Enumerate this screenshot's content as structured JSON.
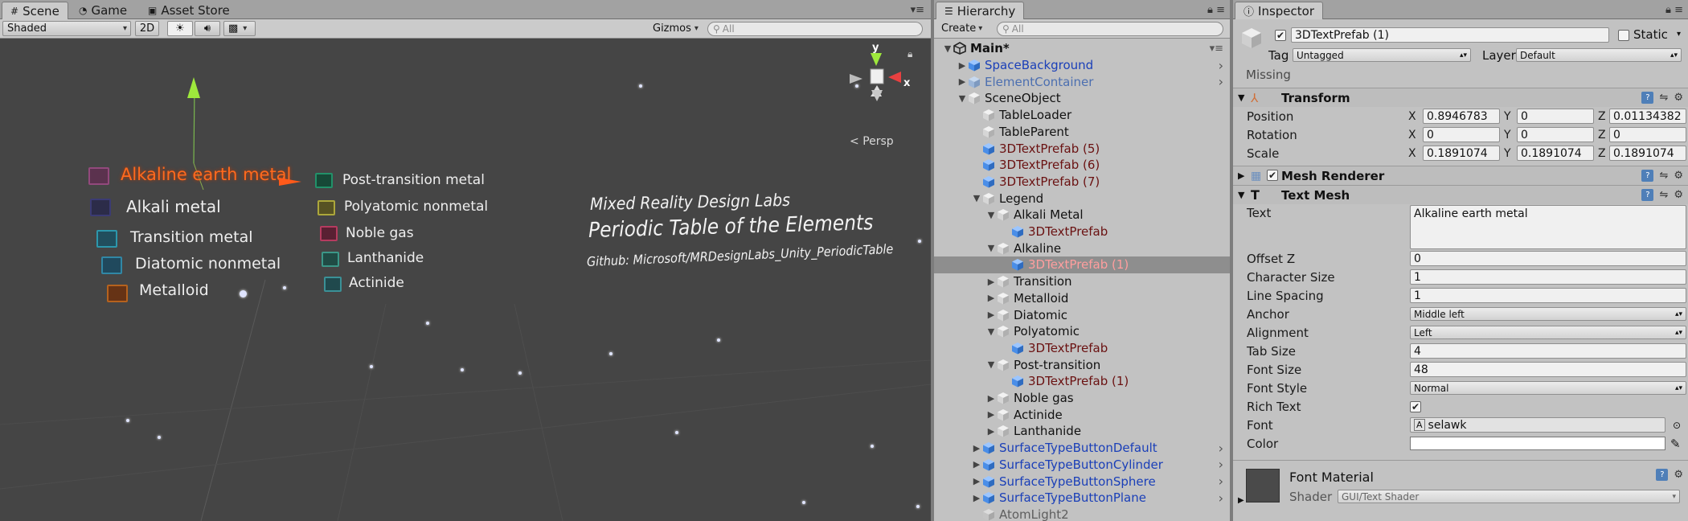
{
  "scene_panel": {
    "tabs": [
      {
        "label": "Scene",
        "icon": "grid-icon"
      },
      {
        "label": "Game",
        "icon": "pacman-icon"
      },
      {
        "label": "Asset Store",
        "icon": "store-icon"
      }
    ],
    "toolbar": {
      "shading": "Shaded",
      "mode_2d": "2D",
      "gizmos": "Gizmos",
      "search_placeholder": "All"
    },
    "persp_label": "Persp",
    "gizmo_axes": {
      "y": "y",
      "x": "x"
    },
    "legend": {
      "left": [
        {
          "label": "Alkaline earth metal",
          "color": "#ff6a1e",
          "box": "#9b4a82",
          "highlight": true
        },
        {
          "label": "Alkali metal",
          "color": "#eeeeee",
          "box": "#3b3a7a"
        },
        {
          "label": "Transition metal",
          "color": "#eeeeee",
          "box": "#2aa0b8"
        },
        {
          "label": "Diatomic nonmetal",
          "color": "#eeeeee",
          "box": "#2f8fb0"
        },
        {
          "label": "Metalloid",
          "color": "#eeeeee",
          "box": "#c2661a"
        }
      ],
      "right": [
        {
          "label": "Post-transition metal",
          "box": "#1f9a6e"
        },
        {
          "label": "Polyatomic nonmetal",
          "box": "#b8b23a"
        },
        {
          "label": "Noble gas",
          "box": "#c23a62"
        },
        {
          "label": "Lanthanide",
          "box": "#3aa090"
        },
        {
          "label": "Actinide",
          "box": "#3a9aa0"
        }
      ]
    },
    "titles": {
      "lab": "Mixed Reality Design Labs",
      "main": "Periodic Table of the Elements",
      "github": "Github: Microsoft/MRDesignLabs_Unity_PeriodicTable"
    }
  },
  "hierarchy_panel": {
    "tab": "Hierarchy",
    "create": "Create",
    "search_placeholder": "All",
    "rows": [
      {
        "name": "Main*",
        "indent": 0,
        "fold": "down",
        "style": "scene",
        "icon": "unity-scene-icon",
        "menu": true
      },
      {
        "name": "SpaceBackground",
        "indent": 1,
        "fold": "right",
        "style": "prefab",
        "icon": "prefab-cube-icon",
        "arrow": true
      },
      {
        "name": "ElementContainer",
        "indent": 1,
        "fold": "right",
        "style": "prefab-dim",
        "icon": "prefab-cube-icon",
        "arrow": true
      },
      {
        "name": "SceneObject",
        "indent": 1,
        "fold": "down",
        "style": "normal",
        "icon": "cube-icon"
      },
      {
        "name": "TableLoader",
        "indent": 2,
        "fold": "",
        "style": "normal",
        "icon": "cube-icon"
      },
      {
        "name": "TableParent",
        "indent": 2,
        "fold": "",
        "style": "normal",
        "icon": "cube-icon"
      },
      {
        "name": "3DTextPrefab (5)",
        "indent": 2,
        "fold": "",
        "style": "broken",
        "icon": "prefab-cube-icon"
      },
      {
        "name": "3DTextPrefab (6)",
        "indent": 2,
        "fold": "",
        "style": "broken",
        "icon": "prefab-cube-icon"
      },
      {
        "name": "3DTextPrefab (7)",
        "indent": 2,
        "fold": "",
        "style": "broken",
        "icon": "prefab-cube-icon"
      },
      {
        "name": "Legend",
        "indent": 2,
        "fold": "down",
        "style": "normal",
        "icon": "cube-icon"
      },
      {
        "name": "Alkali Metal",
        "indent": 3,
        "fold": "down",
        "style": "normal",
        "icon": "cube-icon"
      },
      {
        "name": "3DTextPrefab",
        "indent": 4,
        "fold": "",
        "style": "broken",
        "icon": "prefab-cube-icon"
      },
      {
        "name": "Alkaline",
        "indent": 3,
        "fold": "down",
        "style": "normal",
        "icon": "cube-icon"
      },
      {
        "name": "3DTextPrefab (1)",
        "indent": 4,
        "fold": "",
        "style": "sel",
        "icon": "prefab-cube-icon",
        "selected": true
      },
      {
        "name": "Transition",
        "indent": 3,
        "fold": "right",
        "style": "normal",
        "icon": "cube-icon"
      },
      {
        "name": "Metalloid",
        "indent": 3,
        "fold": "right",
        "style": "normal",
        "icon": "cube-icon"
      },
      {
        "name": "Diatomic",
        "indent": 3,
        "fold": "right",
        "style": "normal",
        "icon": "cube-icon"
      },
      {
        "name": "Polyatomic",
        "indent": 3,
        "fold": "down",
        "style": "normal",
        "icon": "cube-icon"
      },
      {
        "name": "3DTextPrefab",
        "indent": 4,
        "fold": "",
        "style": "broken",
        "icon": "prefab-cube-icon"
      },
      {
        "name": "Post-transition",
        "indent": 3,
        "fold": "down",
        "style": "normal",
        "icon": "cube-icon"
      },
      {
        "name": "3DTextPrefab (1)",
        "indent": 4,
        "fold": "",
        "style": "broken",
        "icon": "prefab-cube-icon"
      },
      {
        "name": "Noble gas",
        "indent": 3,
        "fold": "right",
        "style": "normal",
        "icon": "cube-icon"
      },
      {
        "name": "Actinide",
        "indent": 3,
        "fold": "right",
        "style": "normal",
        "icon": "cube-icon"
      },
      {
        "name": "Lanthanide",
        "indent": 3,
        "fold": "right",
        "style": "normal",
        "icon": "cube-icon"
      },
      {
        "name": "SurfaceTypeButtonDefault",
        "indent": 2,
        "fold": "right",
        "style": "prefab",
        "icon": "prefab-cube-icon",
        "arrow": true
      },
      {
        "name": "SurfaceTypeButtonCylinder",
        "indent": 2,
        "fold": "right",
        "style": "prefab",
        "icon": "prefab-cube-icon",
        "arrow": true
      },
      {
        "name": "SurfaceTypeButtonSphere",
        "indent": 2,
        "fold": "right",
        "style": "prefab",
        "icon": "prefab-cube-icon",
        "arrow": true
      },
      {
        "name": "SurfaceTypeButtonPlane",
        "indent": 2,
        "fold": "right",
        "style": "prefab",
        "icon": "prefab-cube-icon",
        "arrow": true
      },
      {
        "name": "AtomLight2",
        "indent": 2,
        "fold": "",
        "style": "disabled",
        "icon": "cube-icon"
      }
    ]
  },
  "inspector_panel": {
    "tab": "Inspector",
    "object_name": "3DTextPrefab (1)",
    "active": true,
    "static_label": "Static",
    "tag_label": "Tag",
    "tag_value": "Untagged",
    "layer_label": "Layer",
    "layer_value": "Default",
    "missing_label": "Missing",
    "transform": {
      "title": "Transform",
      "position": {
        "label": "Position",
        "x": "0.8946783",
        "y": "0",
        "z": "0.01134382"
      },
      "rotation": {
        "label": "Rotation",
        "x": "0",
        "y": "0",
        "z": "0"
      },
      "scale": {
        "label": "Scale",
        "x": "0.1891074",
        "y": "0.1891074",
        "z": "0.1891074"
      },
      "axis_x": "X",
      "axis_y": "Y",
      "axis_z": "Z"
    },
    "mesh_renderer": {
      "title": "Mesh Renderer",
      "enabled": true
    },
    "text_mesh": {
      "title": "Text Mesh",
      "text_label": "Text",
      "text_value": "Alkaline earth metal",
      "offset_z": {
        "label": "Offset Z",
        "value": "0"
      },
      "character_size": {
        "label": "Character Size",
        "value": "1"
      },
      "line_spacing": {
        "label": "Line Spacing",
        "value": "1"
      },
      "anchor": {
        "label": "Anchor",
        "value": "Middle left"
      },
      "alignment": {
        "label": "Alignment",
        "value": "Left"
      },
      "tab_size": {
        "label": "Tab Size",
        "value": "4"
      },
      "font_size": {
        "label": "Font Size",
        "value": "48"
      },
      "font_style": {
        "label": "Font Style",
        "value": "Normal"
      },
      "rich_text": {
        "label": "Rich Text",
        "checked": true
      },
      "font": {
        "label": "Font",
        "value": "selawk"
      },
      "color": {
        "label": "Color",
        "value": "#ffffff"
      }
    },
    "material": {
      "title": "Font Material",
      "shader_label": "Shader",
      "shader_value": "GUI/Text Shader"
    }
  }
}
